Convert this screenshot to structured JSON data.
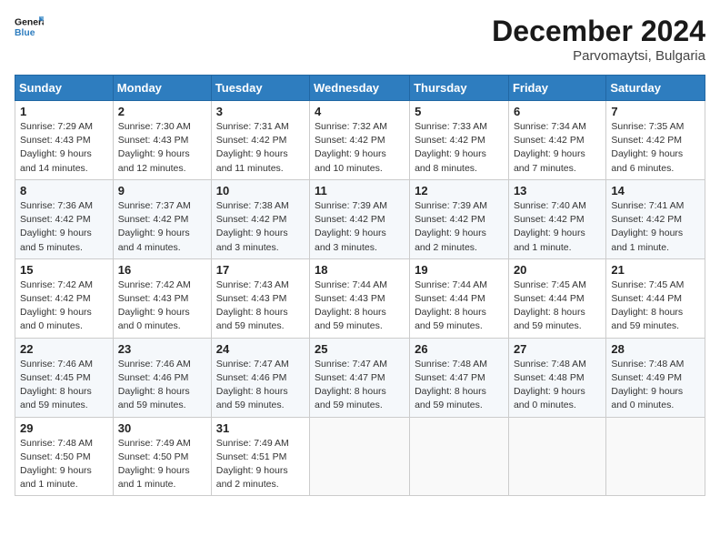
{
  "header": {
    "logo_line1": "General",
    "logo_line2": "Blue",
    "month_title": "December 2024",
    "location": "Parvomaytsi, Bulgaria"
  },
  "weekdays": [
    "Sunday",
    "Monday",
    "Tuesday",
    "Wednesday",
    "Thursday",
    "Friday",
    "Saturday"
  ],
  "weeks": [
    [
      {
        "day": "1",
        "sunrise": "Sunrise: 7:29 AM",
        "sunset": "Sunset: 4:43 PM",
        "daylight": "Daylight: 9 hours and 14 minutes."
      },
      {
        "day": "2",
        "sunrise": "Sunrise: 7:30 AM",
        "sunset": "Sunset: 4:43 PM",
        "daylight": "Daylight: 9 hours and 12 minutes."
      },
      {
        "day": "3",
        "sunrise": "Sunrise: 7:31 AM",
        "sunset": "Sunset: 4:42 PM",
        "daylight": "Daylight: 9 hours and 11 minutes."
      },
      {
        "day": "4",
        "sunrise": "Sunrise: 7:32 AM",
        "sunset": "Sunset: 4:42 PM",
        "daylight": "Daylight: 9 hours and 10 minutes."
      },
      {
        "day": "5",
        "sunrise": "Sunrise: 7:33 AM",
        "sunset": "Sunset: 4:42 PM",
        "daylight": "Daylight: 9 hours and 8 minutes."
      },
      {
        "day": "6",
        "sunrise": "Sunrise: 7:34 AM",
        "sunset": "Sunset: 4:42 PM",
        "daylight": "Daylight: 9 hours and 7 minutes."
      },
      {
        "day": "7",
        "sunrise": "Sunrise: 7:35 AM",
        "sunset": "Sunset: 4:42 PM",
        "daylight": "Daylight: 9 hours and 6 minutes."
      }
    ],
    [
      {
        "day": "8",
        "sunrise": "Sunrise: 7:36 AM",
        "sunset": "Sunset: 4:42 PM",
        "daylight": "Daylight: 9 hours and 5 minutes."
      },
      {
        "day": "9",
        "sunrise": "Sunrise: 7:37 AM",
        "sunset": "Sunset: 4:42 PM",
        "daylight": "Daylight: 9 hours and 4 minutes."
      },
      {
        "day": "10",
        "sunrise": "Sunrise: 7:38 AM",
        "sunset": "Sunset: 4:42 PM",
        "daylight": "Daylight: 9 hours and 3 minutes."
      },
      {
        "day": "11",
        "sunrise": "Sunrise: 7:39 AM",
        "sunset": "Sunset: 4:42 PM",
        "daylight": "Daylight: 9 hours and 3 minutes."
      },
      {
        "day": "12",
        "sunrise": "Sunrise: 7:39 AM",
        "sunset": "Sunset: 4:42 PM",
        "daylight": "Daylight: 9 hours and 2 minutes."
      },
      {
        "day": "13",
        "sunrise": "Sunrise: 7:40 AM",
        "sunset": "Sunset: 4:42 PM",
        "daylight": "Daylight: 9 hours and 1 minute."
      },
      {
        "day": "14",
        "sunrise": "Sunrise: 7:41 AM",
        "sunset": "Sunset: 4:42 PM",
        "daylight": "Daylight: 9 hours and 1 minute."
      }
    ],
    [
      {
        "day": "15",
        "sunrise": "Sunrise: 7:42 AM",
        "sunset": "Sunset: 4:42 PM",
        "daylight": "Daylight: 9 hours and 0 minutes."
      },
      {
        "day": "16",
        "sunrise": "Sunrise: 7:42 AM",
        "sunset": "Sunset: 4:43 PM",
        "daylight": "Daylight: 9 hours and 0 minutes."
      },
      {
        "day": "17",
        "sunrise": "Sunrise: 7:43 AM",
        "sunset": "Sunset: 4:43 PM",
        "daylight": "Daylight: 8 hours and 59 minutes."
      },
      {
        "day": "18",
        "sunrise": "Sunrise: 7:44 AM",
        "sunset": "Sunset: 4:43 PM",
        "daylight": "Daylight: 8 hours and 59 minutes."
      },
      {
        "day": "19",
        "sunrise": "Sunrise: 7:44 AM",
        "sunset": "Sunset: 4:44 PM",
        "daylight": "Daylight: 8 hours and 59 minutes."
      },
      {
        "day": "20",
        "sunrise": "Sunrise: 7:45 AM",
        "sunset": "Sunset: 4:44 PM",
        "daylight": "Daylight: 8 hours and 59 minutes."
      },
      {
        "day": "21",
        "sunrise": "Sunrise: 7:45 AM",
        "sunset": "Sunset: 4:44 PM",
        "daylight": "Daylight: 8 hours and 59 minutes."
      }
    ],
    [
      {
        "day": "22",
        "sunrise": "Sunrise: 7:46 AM",
        "sunset": "Sunset: 4:45 PM",
        "daylight": "Daylight: 8 hours and 59 minutes."
      },
      {
        "day": "23",
        "sunrise": "Sunrise: 7:46 AM",
        "sunset": "Sunset: 4:46 PM",
        "daylight": "Daylight: 8 hours and 59 minutes."
      },
      {
        "day": "24",
        "sunrise": "Sunrise: 7:47 AM",
        "sunset": "Sunset: 4:46 PM",
        "daylight": "Daylight: 8 hours and 59 minutes."
      },
      {
        "day": "25",
        "sunrise": "Sunrise: 7:47 AM",
        "sunset": "Sunset: 4:47 PM",
        "daylight": "Daylight: 8 hours and 59 minutes."
      },
      {
        "day": "26",
        "sunrise": "Sunrise: 7:48 AM",
        "sunset": "Sunset: 4:47 PM",
        "daylight": "Daylight: 8 hours and 59 minutes."
      },
      {
        "day": "27",
        "sunrise": "Sunrise: 7:48 AM",
        "sunset": "Sunset: 4:48 PM",
        "daylight": "Daylight: 9 hours and 0 minutes."
      },
      {
        "day": "28",
        "sunrise": "Sunrise: 7:48 AM",
        "sunset": "Sunset: 4:49 PM",
        "daylight": "Daylight: 9 hours and 0 minutes."
      }
    ],
    [
      {
        "day": "29",
        "sunrise": "Sunrise: 7:48 AM",
        "sunset": "Sunset: 4:50 PM",
        "daylight": "Daylight: 9 hours and 1 minute."
      },
      {
        "day": "30",
        "sunrise": "Sunrise: 7:49 AM",
        "sunset": "Sunset: 4:50 PM",
        "daylight": "Daylight: 9 hours and 1 minute."
      },
      {
        "day": "31",
        "sunrise": "Sunrise: 7:49 AM",
        "sunset": "Sunset: 4:51 PM",
        "daylight": "Daylight: 9 hours and 2 minutes."
      },
      null,
      null,
      null,
      null
    ]
  ]
}
